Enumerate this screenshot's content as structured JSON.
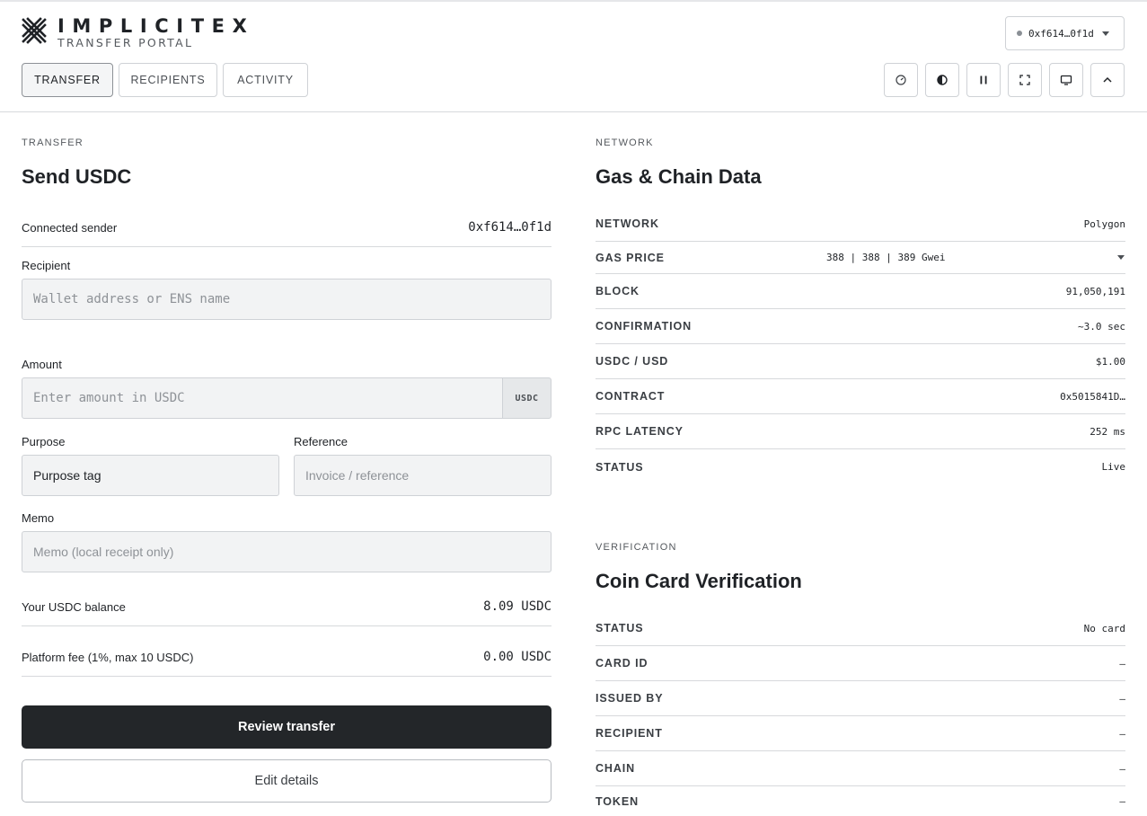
{
  "brand": {
    "name": "IMPLICITEX",
    "subtitle": "TRANSFER PORTAL"
  },
  "wallet": {
    "address": "0xf614…0f1d"
  },
  "tabs": [
    {
      "label": "TRANSFER",
      "active": true
    },
    {
      "label": "RECIPIENTS",
      "active": false
    },
    {
      "label": "ACTIVITY",
      "active": false
    }
  ],
  "toolbar": {
    "icons": [
      "gauge-icon",
      "contrast-icon",
      "pause-icon",
      "fullscreen-icon",
      "monitor-icon",
      "chevron-up-icon"
    ]
  },
  "transfer": {
    "eyebrow": "TRANSFER",
    "title": "Send USDC",
    "sender_label": "Connected sender",
    "sender_value": "0xf614…0f1d",
    "recipient_label": "Recipient",
    "recipient_placeholder": "Wallet address or ENS name",
    "amount_label": "Amount",
    "amount_placeholder": "Enter amount in USDC",
    "amount_unit": "USDC",
    "purpose_label": "Purpose",
    "purpose_value": "Purpose tag",
    "reference_label": "Reference",
    "reference_placeholder": "Invoice / reference",
    "memo_label": "Memo",
    "memo_placeholder": "Memo (local receipt only)",
    "balance_label": "Your USDC balance",
    "balance_value": "8.09 USDC",
    "fee_label": "Platform fee (1%, max 10 USDC)",
    "fee_value": "0.00 USDC",
    "review_button": "Review transfer",
    "edit_button": "Edit details"
  },
  "network": {
    "eyebrow": "NETWORK",
    "title": "Gas & Chain Data",
    "rows": [
      {
        "label": "NETWORK",
        "value": "Polygon"
      },
      {
        "label": "GAS PRICE",
        "value": "388 | 388 | 389 Gwei"
      },
      {
        "label": "BLOCK",
        "value": "91,050,191"
      },
      {
        "label": "CONFIRMATION",
        "value": "~3.0 sec"
      },
      {
        "label": "USDC / USD",
        "value": "$1.00"
      },
      {
        "label": "CONTRACT",
        "value": "0x5015841D…"
      },
      {
        "label": "RPC LATENCY",
        "value": "252 ms"
      },
      {
        "label": "STATUS",
        "value": "Live"
      }
    ]
  },
  "verification": {
    "eyebrow": "VERIFICATION",
    "title": "Coin Card Verification",
    "rows": [
      {
        "label": "STATUS",
        "value": "No card"
      },
      {
        "label": "CARD ID",
        "value": "–"
      },
      {
        "label": "ISSUED BY",
        "value": "–"
      },
      {
        "label": "RECIPIENT",
        "value": "–"
      },
      {
        "label": "CHAIN",
        "value": "–"
      },
      {
        "label": "TOKEN",
        "value": "–"
      }
    ]
  }
}
